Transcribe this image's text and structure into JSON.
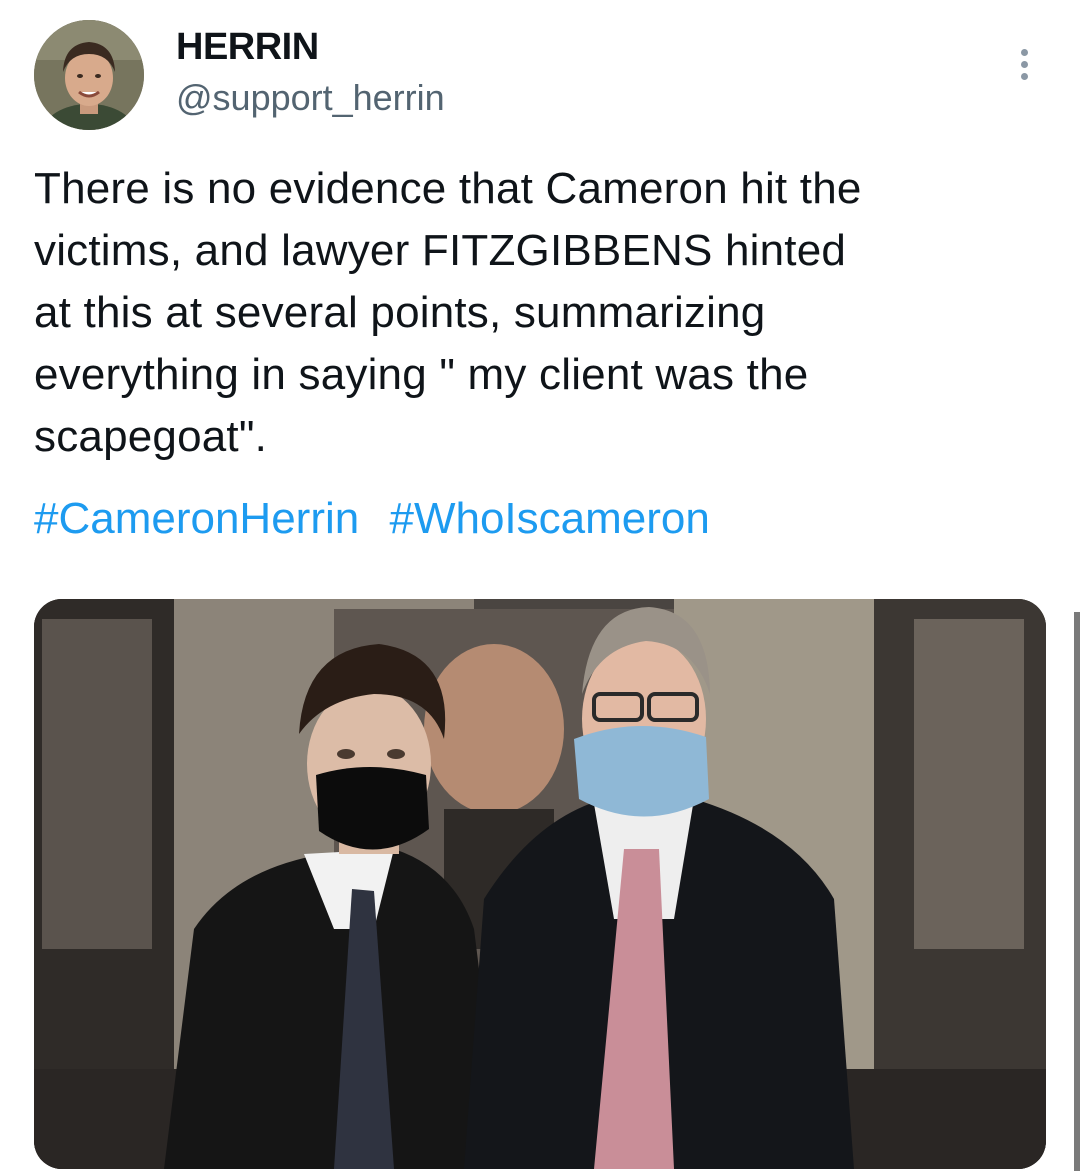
{
  "author": {
    "display_name": "HERRIN",
    "handle": "@support_herrin"
  },
  "tweet": {
    "text_lines": [
      "There is no evidence that Cameron hit the",
      "victims, and lawyer FITZGIBBENS hinted",
      "at this at several points, summarizing",
      "everything in saying \" my client was the",
      "scapegoat\"."
    ],
    "hashtags": [
      "#CameronHerrin",
      "#WhoIscameron"
    ]
  },
  "icons": {
    "more": "more-vertical-icon"
  },
  "colors": {
    "text": "#0f1419",
    "secondary_text": "#536471",
    "link": "#1d9bf0"
  }
}
